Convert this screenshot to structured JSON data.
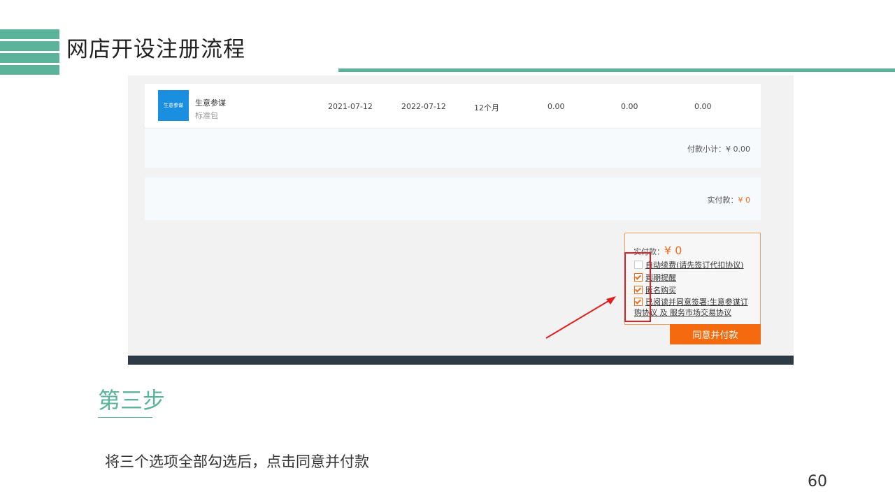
{
  "slide": {
    "title": "网店开设注册流程",
    "step_title": "第三步",
    "step_desc": "将三个选项全部勾选后，点击同意并付款",
    "page_number": "60",
    "accent_color": "#5bb49a"
  },
  "order": {
    "logo_text": "生意参谋",
    "product_name": "生意参谋",
    "package": "标准包",
    "start_date": "2021-07-12",
    "end_date": "2022-07-12",
    "duration": "12个月",
    "value1": "0.00",
    "value2": "0.00",
    "value3": "0.00"
  },
  "subtotal": {
    "label": "付款小计：",
    "amount": "¥ 0.00"
  },
  "payment": {
    "label": "实付款：",
    "amount": "¥ 0"
  },
  "checkout": {
    "total_label": "实付款：",
    "total_amount": "¥ 0",
    "options": [
      {
        "label": "自动续费(请先签订代扣协议)",
        "checked": false
      },
      {
        "label": "到期提醒",
        "checked": true
      },
      {
        "label": "匿名购买",
        "checked": true
      },
      {
        "label": "已阅读并同意签署:生意参谋订购协议 及 服务市场交易协议",
        "checked": true
      }
    ],
    "agree_button": "同意并付款",
    "button_color": "#f56a0e",
    "highlight_color": "#e02020"
  }
}
